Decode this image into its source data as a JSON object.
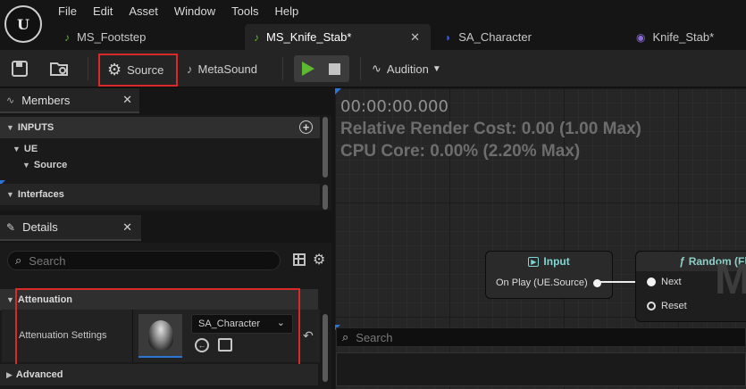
{
  "menu": [
    "File",
    "Edit",
    "Asset",
    "Window",
    "Tools",
    "Help"
  ],
  "logo_text": "U",
  "tabs": [
    {
      "label": "MS_Footstep",
      "icon": "metasound-icon",
      "active": false
    },
    {
      "label": "MS_Knife_Stab*",
      "icon": "metasound-icon",
      "active": true,
      "close": "✕"
    },
    {
      "label": "SA_Character",
      "icon": "sound-attenuation-icon",
      "active": false
    },
    {
      "label": "Knife_Stab*",
      "icon": "metasound-source-icon",
      "active": false
    }
  ],
  "toolbar": {
    "source_label": "Source",
    "metasound_label": "MetaSound",
    "audition_label": "Audition"
  },
  "members_panel": {
    "title": "Members",
    "inputs_label": "INPUTS",
    "ue_label": "UE",
    "source_label": "Source",
    "interfaces_label": "Interfaces"
  },
  "details_panel": {
    "title": "Details",
    "search_placeholder": "Search",
    "attenuation_category": "Attenuation",
    "attenuation_settings_label": "Attenuation Settings",
    "attenuation_asset": "SA_Character",
    "advanced_category": "Advanced"
  },
  "graph": {
    "time": "00:00:00.000",
    "render_cost": "Relative Render Cost: 0.00 (1.00 Max)",
    "cpu_core": "CPU Core: 0.00% (2.20% Max)",
    "input_node": {
      "title": "Input",
      "pin": "On Play (UE.Source)"
    },
    "random_node": {
      "title": "Random (Fl",
      "pins": [
        "Next",
        "Reset"
      ],
      "watermark": "M"
    },
    "search_placeholder": "Search"
  },
  "colors": {
    "highlight": "#d92a2a",
    "accent_blue": "#2b74d8",
    "play_green": "#5fb832"
  }
}
